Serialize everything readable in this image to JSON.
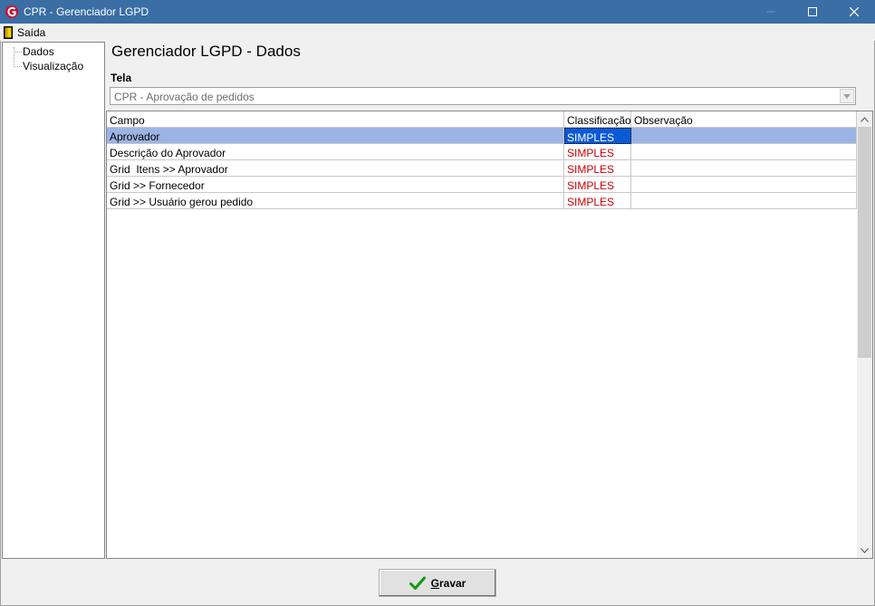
{
  "window": {
    "title": "CPR - Gerenciador LGPD",
    "minimize_icon": "minimize-icon",
    "maximize_icon": "maximize-icon",
    "close_icon": "close-icon"
  },
  "menu": {
    "exit_label": "Saída",
    "exit_icon": "door-exit-icon"
  },
  "tree": {
    "items": [
      {
        "label": "Dados"
      },
      {
        "label": "Visualização"
      }
    ]
  },
  "main": {
    "title": "Gerenciador LGPD - Dados",
    "tela_label": "Tela",
    "screen_select": {
      "value": "CPR - Aprovação de pedidos"
    }
  },
  "grid": {
    "columns": [
      "Campo",
      "Classificação",
      "Observação"
    ],
    "rows": [
      {
        "campo": "Aprovador",
        "classificacao": "SIMPLES",
        "observacao": "",
        "selected": true
      },
      {
        "campo": "Descrição do Aprovador",
        "classificacao": "SIMPLES",
        "observacao": ""
      },
      {
        "campo": "Grid  Itens >> Aprovador",
        "classificacao": "SIMPLES",
        "observacao": ""
      },
      {
        "campo": "Grid >> Fornecedor",
        "classificacao": "SIMPLES",
        "observacao": ""
      },
      {
        "campo": "Grid >> Usuário gerou pedido",
        "classificacao": "SIMPLES",
        "observacao": ""
      }
    ]
  },
  "footer": {
    "save_label": "Gravar",
    "save_icon": "checkmark-icon"
  },
  "colors": {
    "titlebar": "#3a6ea5",
    "selected_row": "#9cb4e4",
    "selected_cell": "#0a5ad6",
    "classification_text": "#cc0000"
  }
}
